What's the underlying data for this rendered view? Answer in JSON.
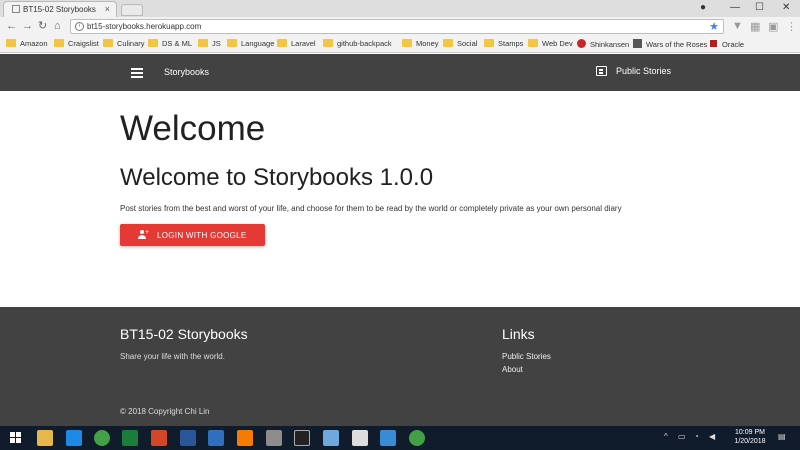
{
  "browser": {
    "tab_title": "BT15-02 Storybooks",
    "url": "bt15-storybooks.herokuapp.com",
    "window_controls": [
      "—",
      "☐",
      "✕"
    ]
  },
  "bookmarks": [
    {
      "label": "Amazon",
      "icon": "folder-icon"
    },
    {
      "label": "Craigslist",
      "icon": "folder-icon"
    },
    {
      "label": "Culinary",
      "icon": "folder-icon"
    },
    {
      "label": "DS & ML",
      "icon": "folder-icon"
    },
    {
      "label": "JS",
      "icon": "folder-icon"
    },
    {
      "label": "Language",
      "icon": "folder-icon"
    },
    {
      "label": "Laravel",
      "icon": "folder-icon"
    },
    {
      "label": "github-backpack",
      "icon": "folder-icon"
    },
    {
      "label": "Money",
      "icon": "folder-icon"
    },
    {
      "label": "Social",
      "icon": "folder-icon"
    },
    {
      "label": "Stamps",
      "icon": "folder-icon"
    },
    {
      "label": "Web Dev",
      "icon": "folder-icon"
    },
    {
      "label": "Shinkansen",
      "icon": "red-dot-icon"
    },
    {
      "label": "Wars of the Roses",
      "icon": "site-icon"
    },
    {
      "label": "Oracle",
      "icon": "oracle-icon"
    }
  ],
  "nav": {
    "brand": "Storybooks",
    "public_stories": "Public Stories"
  },
  "main": {
    "heading": "Welcome",
    "subheading": "Welcome to Storybooks 1.0.0",
    "lead": "Post stories from the best and worst of your life, and choose for them to be read by the world or completely private as your own personal diary",
    "login_button": "LOGIN WITH GOOGLE"
  },
  "footer": {
    "title": "BT15-02 Storybooks",
    "tagline": "Share your life with the world.",
    "links_title": "Links",
    "links": [
      "Public Stories",
      "About"
    ],
    "copyright": "© 2018 Copyright Chi Lin"
  },
  "taskbar": {
    "time": "10:09 PM",
    "date": "1/20/2018"
  },
  "colors": {
    "nav_bg": "#424242",
    "button_red": "#e53935",
    "taskbar_bg": "#101c2c"
  }
}
